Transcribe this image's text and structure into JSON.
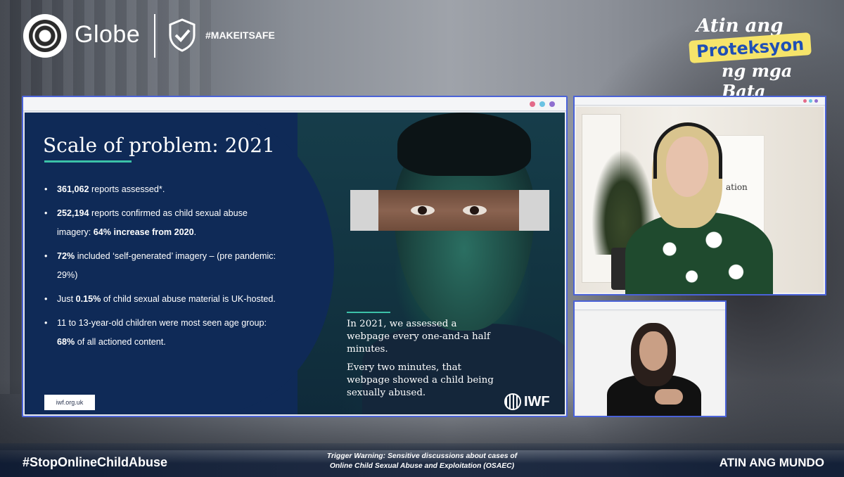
{
  "header": {
    "brand_name": "Globe",
    "hashtag": "#MAKEITSAFE",
    "campaign": {
      "line1": "Atin ang",
      "line2": "Proteksyon",
      "line3": "ng mga Bata"
    }
  },
  "slide": {
    "title": "Scale of problem: 2021",
    "bullets": [
      {
        "bold": "361,062",
        "rest": " reports assessed*."
      },
      {
        "bold": "252,194",
        "rest": " reports confirmed as child sexual abuse imagery: ",
        "bold2": "64% increase from 2020",
        "tail": "."
      },
      {
        "bold": "72%",
        "rest": " included ‘self-generated’ imagery – (pre pandemic: 29%)"
      },
      {
        "pre": "Just ",
        "bold": "0.15%",
        "rest": " of child sexual abuse material is UK-hosted."
      },
      {
        "pre": "11 to 13-year-old children were most seen age group: ",
        "bold": "68%",
        "rest": " of all actioned content."
      }
    ],
    "url": "iwf.org.uk",
    "quote_p1": "In 2021, we assessed a webpage every one-and-a half minutes.",
    "quote_p2": "Every two minutes, that webpage showed a child being sexually abused.",
    "logo_text": "IWF"
  },
  "speaker_tile": {
    "background_sign_text": "ation"
  },
  "footer": {
    "hashtag": "#StopOnlineChildAbuse",
    "warning_line1": "Trigger Warning: Sensitive discussions about cases of",
    "warning_line2": "Online Child Sexual Abuse and Exploitation (OSAEC)",
    "right_label": "ATIN ANG MUNDO"
  },
  "colors": {
    "window_border": "#4a62d8",
    "slide_navy": "#0f2a57",
    "accent_teal": "#3cc2a8",
    "campaign_yellow": "#f6e46a",
    "campaign_blue": "#1f4fb5"
  }
}
